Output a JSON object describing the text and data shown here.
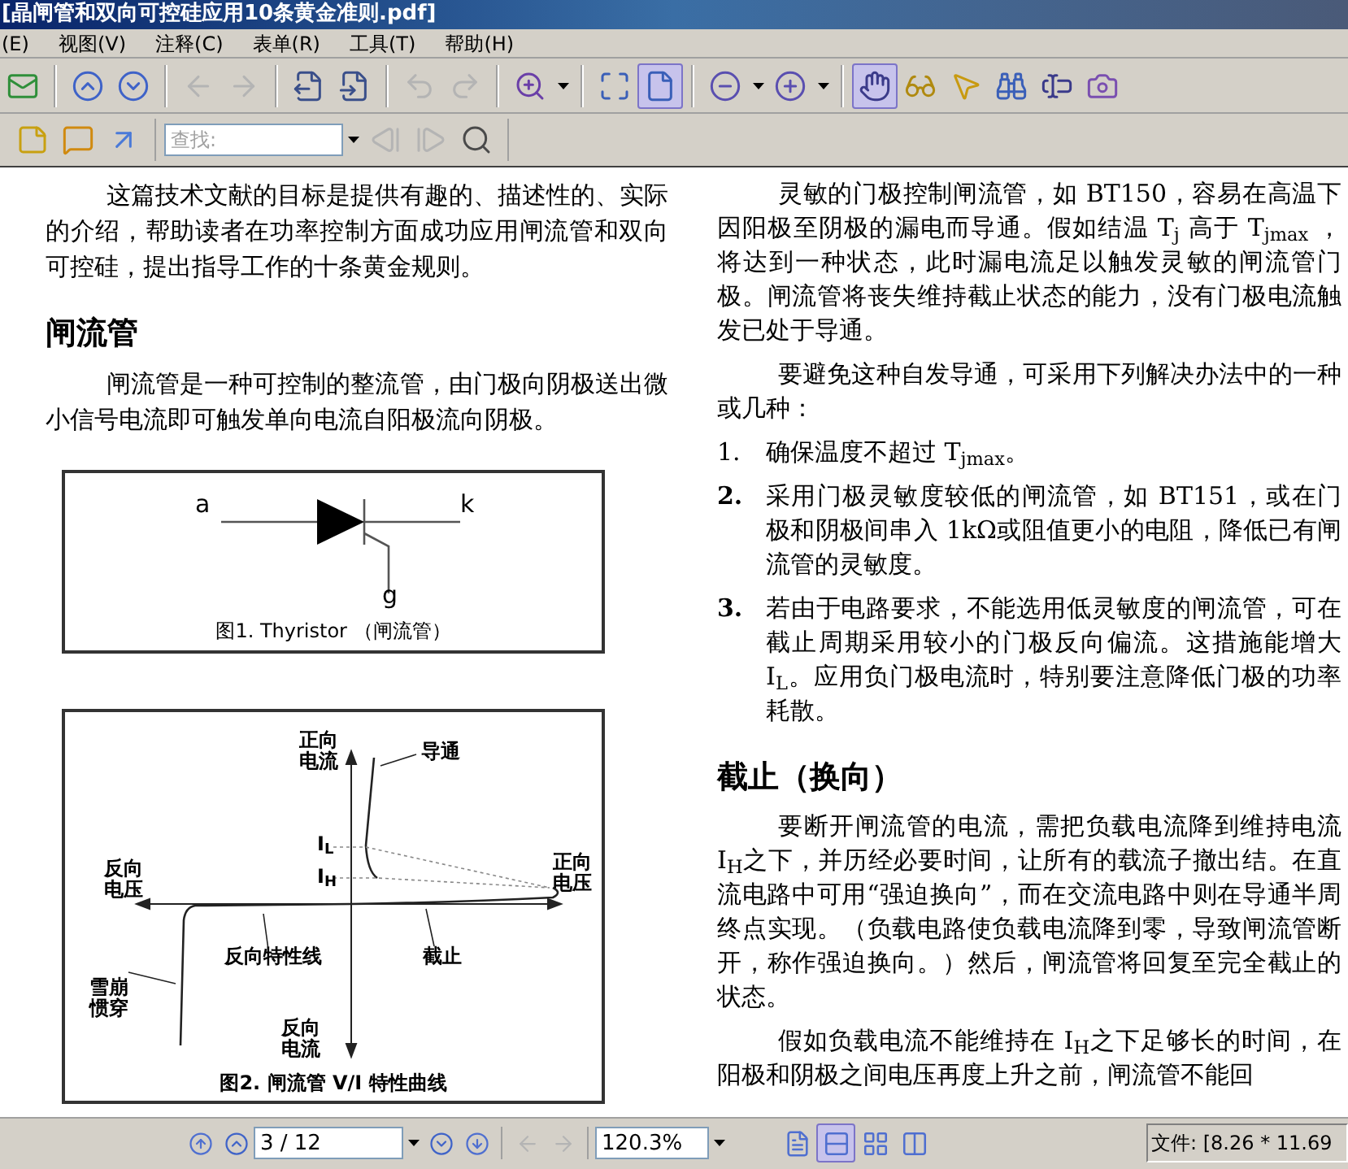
{
  "window": {
    "title": "[晶闸管和双向可控硅应用10条黄金准则.pdf]"
  },
  "menu": [
    "(E)",
    "视图(V)",
    "注释(C)",
    "表单(R)",
    "工具(T)",
    "帮助(H)"
  ],
  "toolbar": [
    {
      "kind": "email",
      "selected": false,
      "disabled": false
    },
    {
      "kind": "separator"
    },
    {
      "kind": "page-up",
      "selected": false,
      "disabled": false
    },
    {
      "kind": "page-down",
      "selected": false,
      "disabled": false
    },
    {
      "kind": "separator"
    },
    {
      "kind": "back",
      "selected": false,
      "disabled": true
    },
    {
      "kind": "forward",
      "selected": false,
      "disabled": true
    },
    {
      "kind": "separator"
    },
    {
      "kind": "extract",
      "selected": false,
      "disabled": false
    },
    {
      "kind": "insert",
      "selected": false,
      "disabled": false
    },
    {
      "kind": "separator"
    },
    {
      "kind": "undo",
      "selected": false,
      "disabled": true
    },
    {
      "kind": "redo",
      "selected": false,
      "disabled": true
    },
    {
      "kind": "separator"
    },
    {
      "kind": "zoom-tool",
      "selected": false,
      "disabled": false,
      "has_menu": true
    },
    {
      "kind": "separator"
    },
    {
      "kind": "fit-page",
      "selected": false,
      "disabled": false
    },
    {
      "kind": "single-page",
      "selected": true,
      "disabled": false
    },
    {
      "kind": "separator"
    },
    {
      "kind": "zoom-out",
      "selected": false,
      "disabled": false,
      "has_menu": true
    },
    {
      "kind": "zoom-in",
      "selected": false,
      "disabled": false,
      "has_menu": true
    },
    {
      "kind": "separator"
    },
    {
      "kind": "hand",
      "selected": true,
      "disabled": false
    },
    {
      "kind": "reading",
      "selected": false,
      "disabled": false
    },
    {
      "kind": "select",
      "selected": false,
      "disabled": false
    },
    {
      "kind": "find",
      "selected": false,
      "disabled": false
    },
    {
      "kind": "text-select",
      "selected": false,
      "disabled": false
    },
    {
      "kind": "snapshot",
      "selected": false,
      "disabled": false
    }
  ],
  "find_toolbar": {
    "tools_before": [
      {
        "kind": "note",
        "selected": false,
        "disabled": false
      },
      {
        "kind": "comment",
        "selected": false,
        "disabled": false
      },
      {
        "kind": "arrow",
        "selected": false,
        "disabled": false
      }
    ],
    "search": {
      "placeholder": "查找:"
    },
    "tools_after": [
      {
        "kind": "find-prev",
        "selected": false,
        "disabled": true
      },
      {
        "kind": "find-next",
        "selected": false,
        "disabled": true
      },
      {
        "kind": "search",
        "selected": false,
        "disabled": false
      }
    ]
  },
  "document": {
    "left": [
      {
        "kind": "paragraph",
        "text": "这篇技术文献的目标是提供有趣的、描述性的、实际的介绍，帮助读者在功率控制方面成功应用闸流管和双向可控硅，提出指导工作的十条黄金规则。"
      },
      {
        "kind": "heading",
        "text": "闸流管"
      },
      {
        "kind": "paragraph",
        "text": "闸流管是一种可控制的整流管，由门极向阴极送出微小信号电流即可触发单向电流自阳极流向阴极。"
      },
      {
        "kind": "thyristor_figure",
        "anode": "a",
        "cathode": "k",
        "gate": "g",
        "caption": "图1. Thyristor （闸流管）"
      },
      {
        "kind": "vi_figure",
        "caption": "图2. 闸流管 V/I 特性曲线",
        "labels": [
          {
            "kind": "forward_current",
            "text": "正向电流"
          },
          {
            "kind": "on_state",
            "text": "导通"
          },
          {
            "kind": "latching",
            "text": "I$_{L}$"
          },
          {
            "kind": "reverse_voltage",
            "text": "反向电压"
          },
          {
            "kind": "holding",
            "text": "I$_{H}$"
          },
          {
            "kind": "forward_voltage",
            "text": "正向电压"
          },
          {
            "kind": "reverse_characteristic",
            "text": "反向特性线"
          },
          {
            "kind": "blocking",
            "text": "截止"
          },
          {
            "kind": "avalanche",
            "text": "雪崩惯穿"
          },
          {
            "kind": "reverse_current",
            "text": "反向电流"
          }
        ]
      }
    ],
    "right": [
      {
        "kind": "paragraph",
        "text": "灵敏的门极控制闸流管，如 BT150，容易在高温下因阳极至阴极的漏电而导通。假如结温 T$_{j}$ 高于 T$_{jmax}$ ，将达到一种状态，此时漏电流足以触发灵敏的闸流管门极。闸流管将丧失维持截止状态的能力，没有门极电流触发已处于导通。"
      },
      {
        "kind": "paragraph",
        "text": "要避免这种自发导通，可采用下列解决办法中的一种或几种："
      },
      {
        "kind": "list_item",
        "number": "1.",
        "number_bold": false,
        "text": "确保温度不超过 T$_{jmax}$。"
      },
      {
        "kind": "list_item",
        "number": "2.",
        "number_bold": true,
        "text": "采用门极灵敏度较低的闸流管，如 BT151，或在门极和阴极间串入 1kΩ或阻值更小的电阻，降低已有闸流管的灵敏度。"
      },
      {
        "kind": "list_item",
        "number": "3.",
        "number_bold": true,
        "text": "若由于电路要求，不能选用低灵敏度的闸流管，可在截止周期采用较小的门极反向偏流。这措施能增大 I$_{L}$。应用负门极电流时，特别要注意降低门极的功率耗散。"
      },
      {
        "kind": "heading",
        "text": "截止（换向）"
      },
      {
        "kind": "paragraph",
        "text": "要断开闸流管的电流，需把负载电流降到维持电流 I$_{H}$之下，并历经必要时间，让所有的载流子撤出结。在直流电路中可用“强迫换向”，而在交流电路中则在导通半周终点实现。（负载电路使负载电流降到零，导致闸流管断开，称作强迫换向。）然后，闸流管将回复至完全截止的状态。"
      },
      {
        "kind": "paragraph",
        "text": "假如负载电流不能维持在 I$_{H}$之下足够长的时间，在阳极和阴极之间电压再度上升之前，闸流管不能回"
      }
    ]
  },
  "status_bar": {
    "nav_before": [
      {
        "kind": "first-page",
        "selected": false,
        "disabled": false
      },
      {
        "kind": "page-up",
        "selected": false,
        "disabled": false
      }
    ],
    "page": {
      "value": "3 / 12"
    },
    "nav_after": [
      {
        "kind": "page-down",
        "selected": false,
        "disabled": false
      },
      {
        "kind": "last-page",
        "selected": false,
        "disabled": false
      }
    ],
    "history": [
      {
        "kind": "back",
        "selected": false,
        "disabled": true
      },
      {
        "kind": "forward",
        "selected": false,
        "disabled": true
      }
    ],
    "zoom": {
      "value": "120.3%"
    },
    "views": [
      {
        "kind": "view-single",
        "selected": false,
        "disabled": false
      },
      {
        "kind": "view-continuous",
        "selected": true,
        "disabled": false
      },
      {
        "kind": "view-facing",
        "selected": false,
        "disabled": false
      },
      {
        "kind": "view-columns",
        "selected": false,
        "disabled": false
      }
    ],
    "file_info": "文件: [8.26 * 11.69"
  }
}
